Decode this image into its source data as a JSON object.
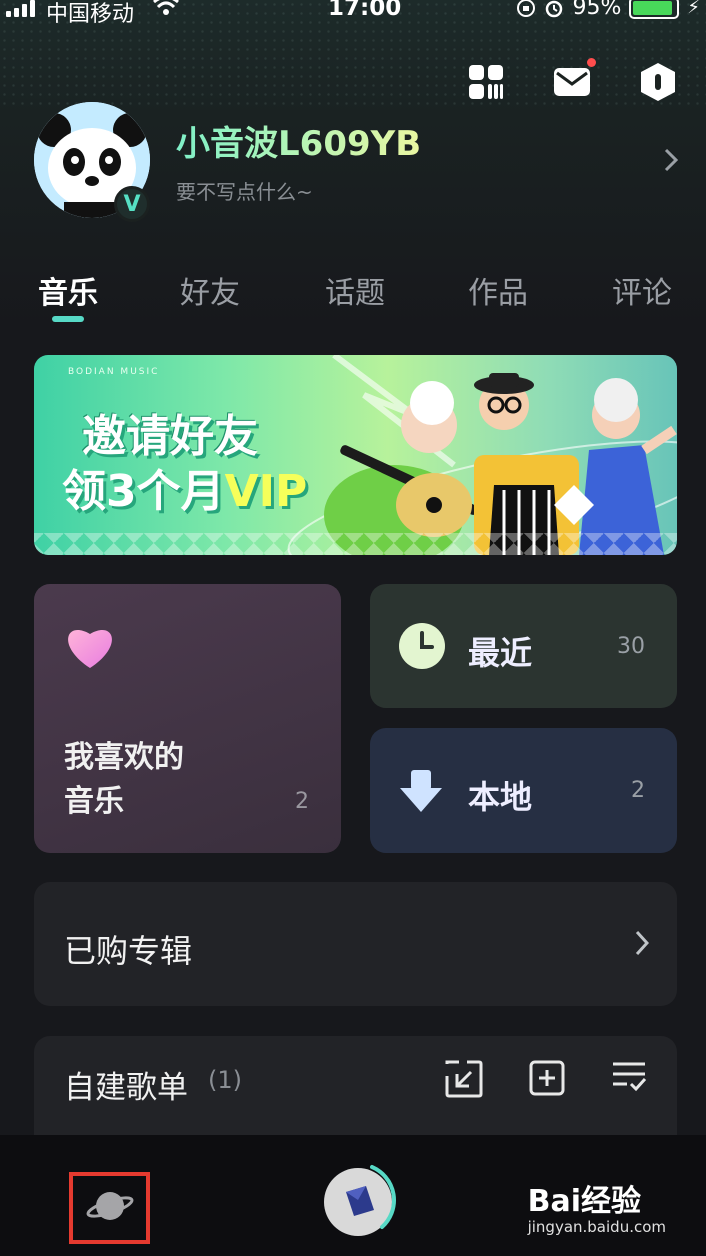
{
  "status_bar": {
    "carrier": "中国移动",
    "time": "17:00",
    "battery": "95%"
  },
  "header": {
    "icons": [
      "grid-icon",
      "mail-icon",
      "settings-hex-icon"
    ],
    "mail_has_badge": true
  },
  "profile": {
    "name": "小音波L609YB",
    "subtitle": "要不写点什么~",
    "badge": "V"
  },
  "tabs": [
    {
      "label": "音乐",
      "active": true
    },
    {
      "label": "好友",
      "active": false
    },
    {
      "label": "话题",
      "active": false
    },
    {
      "label": "作品",
      "active": false
    },
    {
      "label": "评论",
      "active": false
    }
  ],
  "banner": {
    "brand": "BODIAN MUSIC",
    "line1": "邀请好友",
    "line2_prefix": "领3个月",
    "line2_vip": "VIP"
  },
  "cards": {
    "favorites": {
      "label_line1": "我喜欢的",
      "label_line2": "音乐",
      "count": "2"
    },
    "recent": {
      "label": "最近",
      "count": "30"
    },
    "local": {
      "label": "本地",
      "count": "2"
    }
  },
  "purchased": {
    "label": "已购专辑"
  },
  "playlists": {
    "label": "自建歌单",
    "count": "(1)"
  },
  "bottom": {
    "watermark_brand": "Bai经验",
    "watermark_url": "jingyan.baidu.com"
  },
  "colors": {
    "accent": "#57d9c6",
    "highlight_box": "#e53a2f"
  }
}
